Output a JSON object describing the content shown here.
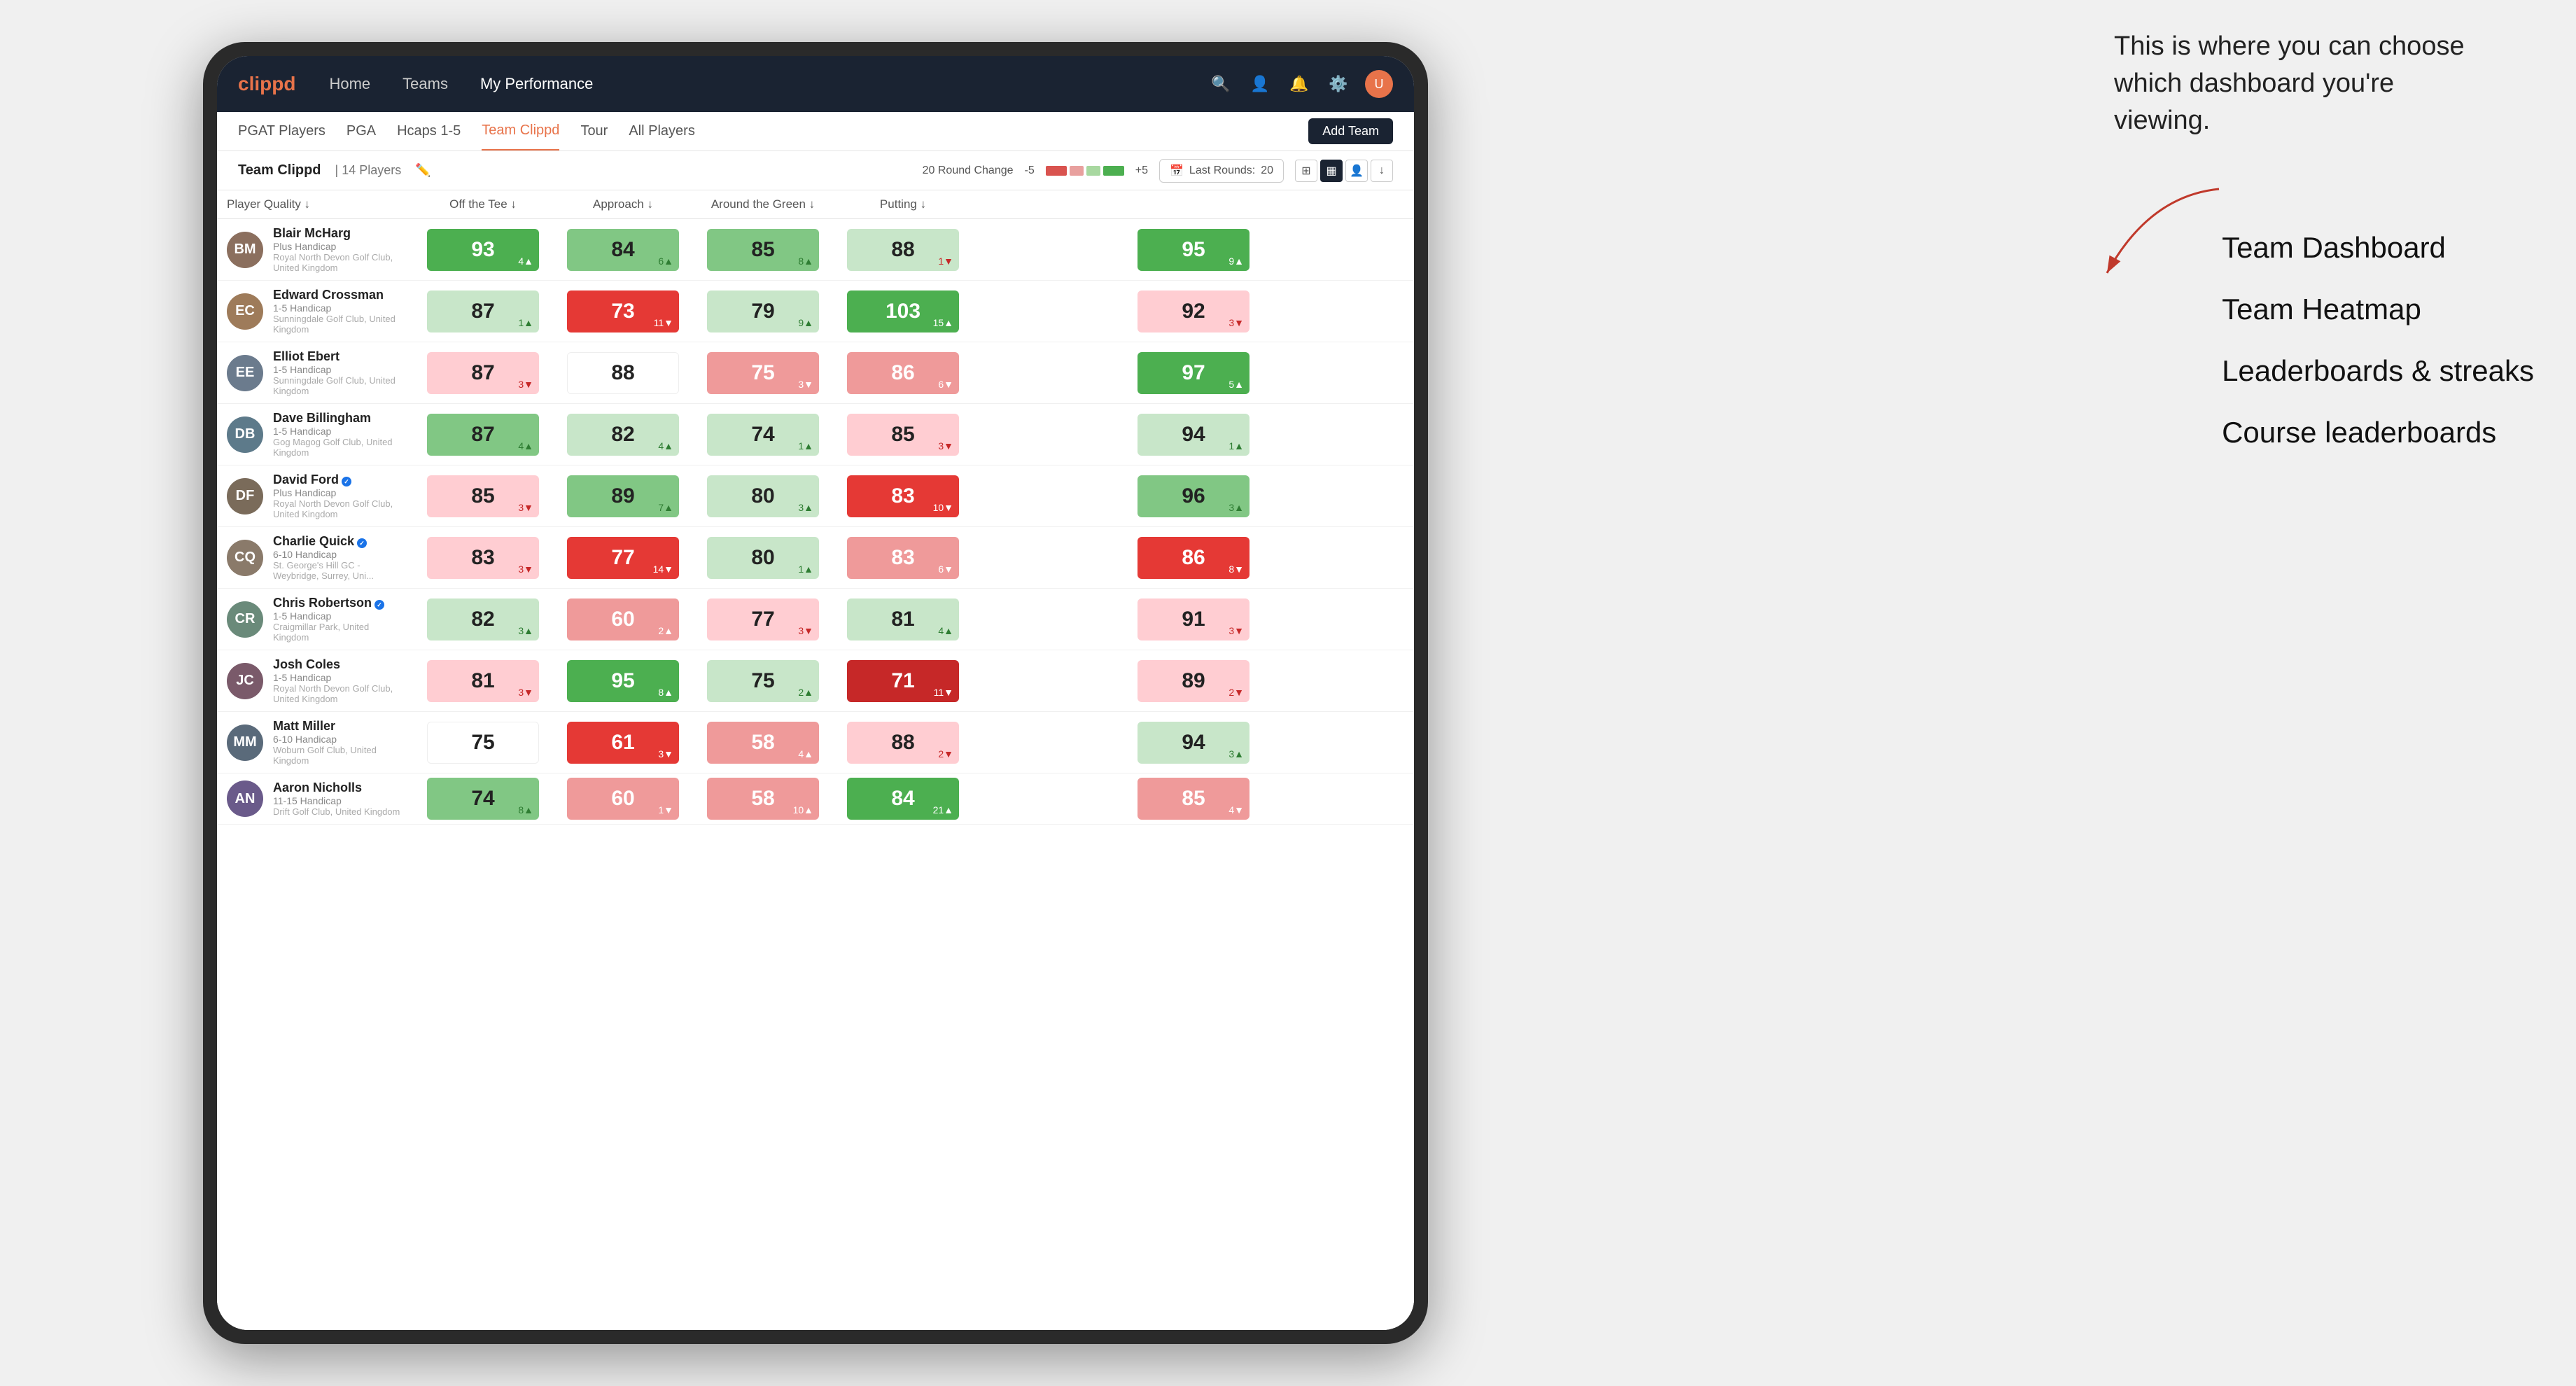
{
  "annotation": {
    "text": "This is where you can choose which dashboard you're viewing.",
    "labels": [
      "Team Dashboard",
      "Team Heatmap",
      "Leaderboards & streaks",
      "Course leaderboards"
    ]
  },
  "navbar": {
    "logo": "clippd",
    "links": [
      "Home",
      "Teams",
      "My Performance"
    ],
    "active_link": "My Performance"
  },
  "sub_tabs": {
    "tabs": [
      "PGAT Players",
      "PGA",
      "Hcaps 1-5",
      "Team Clippd",
      "Tour",
      "All Players"
    ],
    "active_tab": "Team Clippd",
    "add_team_label": "Add Team"
  },
  "team_header": {
    "title": "Team Clippd",
    "separator": "|",
    "count": "14 Players",
    "round_change_label": "20 Round Change",
    "range_min": "-5",
    "range_max": "+5",
    "last_rounds_label": "Last Rounds:",
    "last_rounds_value": "20"
  },
  "table": {
    "columns": [
      {
        "id": "player",
        "label": "Player Quality ↓"
      },
      {
        "id": "off_tee",
        "label": "Off the Tee ↓"
      },
      {
        "id": "approach",
        "label": "Approach ↓"
      },
      {
        "id": "around_green",
        "label": "Around the Green ↓"
      },
      {
        "id": "putting",
        "label": "Putting ↓"
      }
    ],
    "rows": [
      {
        "name": "Blair McHarg",
        "handicap": "Plus Handicap",
        "club": "Royal North Devon Golf Club, United Kingdom",
        "avatar_initials": "BM",
        "avatar_color": "#8B6F5E",
        "player_quality": {
          "value": 93,
          "change": 4,
          "dir": "up",
          "bg": "bg-green-strong"
        },
        "off_tee": {
          "value": 84,
          "change": 6,
          "dir": "up",
          "bg": "bg-green-medium"
        },
        "approach": {
          "value": 85,
          "change": 8,
          "dir": "up",
          "bg": "bg-green-medium"
        },
        "around_green": {
          "value": 88,
          "change": 1,
          "dir": "down",
          "bg": "bg-green-light"
        },
        "putting": {
          "value": 95,
          "change": 9,
          "dir": "up",
          "bg": "bg-green-strong"
        }
      },
      {
        "name": "Edward Crossman",
        "handicap": "1-5 Handicap",
        "club": "Sunningdale Golf Club, United Kingdom",
        "avatar_initials": "EC",
        "avatar_color": "#9E7B5A",
        "player_quality": {
          "value": 87,
          "change": 1,
          "dir": "up",
          "bg": "bg-green-light"
        },
        "off_tee": {
          "value": 73,
          "change": 11,
          "dir": "down",
          "bg": "bg-red-strong"
        },
        "approach": {
          "value": 79,
          "change": 9,
          "dir": "up",
          "bg": "bg-green-light"
        },
        "around_green": {
          "value": 103,
          "change": 15,
          "dir": "up",
          "bg": "bg-green-strong"
        },
        "putting": {
          "value": 92,
          "change": 3,
          "dir": "down",
          "bg": "bg-red-light"
        }
      },
      {
        "name": "Elliot Ebert",
        "handicap": "1-5 Handicap",
        "club": "Sunningdale Golf Club, United Kingdom",
        "avatar_initials": "EE",
        "avatar_color": "#6B7B8D",
        "player_quality": {
          "value": 87,
          "change": 3,
          "dir": "down",
          "bg": "bg-red-light"
        },
        "off_tee": {
          "value": 88,
          "change": 0,
          "dir": "none",
          "bg": "bg-white"
        },
        "approach": {
          "value": 75,
          "change": 3,
          "dir": "down",
          "bg": "bg-red-medium"
        },
        "around_green": {
          "value": 86,
          "change": 6,
          "dir": "down",
          "bg": "bg-red-medium"
        },
        "putting": {
          "value": 97,
          "change": 5,
          "dir": "up",
          "bg": "bg-green-strong"
        }
      },
      {
        "name": "Dave Billingham",
        "handicap": "1-5 Handicap",
        "club": "Gog Magog Golf Club, United Kingdom",
        "avatar_initials": "DB",
        "avatar_color": "#5D7A8A",
        "player_quality": {
          "value": 87,
          "change": 4,
          "dir": "up",
          "bg": "bg-green-medium"
        },
        "off_tee": {
          "value": 82,
          "change": 4,
          "dir": "up",
          "bg": "bg-green-light"
        },
        "approach": {
          "value": 74,
          "change": 1,
          "dir": "up",
          "bg": "bg-green-light"
        },
        "around_green": {
          "value": 85,
          "change": 3,
          "dir": "down",
          "bg": "bg-red-light"
        },
        "putting": {
          "value": 94,
          "change": 1,
          "dir": "up",
          "bg": "bg-green-light"
        }
      },
      {
        "name": "David Ford",
        "handicap": "Plus Handicap",
        "club": "Royal North Devon Golf Club, United Kingdom",
        "avatar_initials": "DF",
        "avatar_color": "#7A6B5A",
        "verified": true,
        "player_quality": {
          "value": 85,
          "change": 3,
          "dir": "down",
          "bg": "bg-red-light"
        },
        "off_tee": {
          "value": 89,
          "change": 7,
          "dir": "up",
          "bg": "bg-green-medium"
        },
        "approach": {
          "value": 80,
          "change": 3,
          "dir": "up",
          "bg": "bg-green-light"
        },
        "around_green": {
          "value": 83,
          "change": 10,
          "dir": "down",
          "bg": "bg-red-strong"
        },
        "putting": {
          "value": 96,
          "change": 3,
          "dir": "up",
          "bg": "bg-green-medium"
        }
      },
      {
        "name": "Charlie Quick",
        "handicap": "6-10 Handicap",
        "club": "St. George's Hill GC - Weybridge, Surrey, Uni...",
        "avatar_initials": "CQ",
        "avatar_color": "#8A7A6A",
        "verified": true,
        "player_quality": {
          "value": 83,
          "change": 3,
          "dir": "down",
          "bg": "bg-red-light"
        },
        "off_tee": {
          "value": 77,
          "change": 14,
          "dir": "down",
          "bg": "bg-red-strong"
        },
        "approach": {
          "value": 80,
          "change": 1,
          "dir": "up",
          "bg": "bg-green-light"
        },
        "around_green": {
          "value": 83,
          "change": 6,
          "dir": "down",
          "bg": "bg-red-medium"
        },
        "putting": {
          "value": 86,
          "change": 8,
          "dir": "down",
          "bg": "bg-red-strong"
        }
      },
      {
        "name": "Chris Robertson",
        "handicap": "1-5 Handicap",
        "club": "Craigmillar Park, United Kingdom",
        "avatar_initials": "CR",
        "avatar_color": "#6A8A7A",
        "verified": true,
        "player_quality": {
          "value": 82,
          "change": 3,
          "dir": "up",
          "bg": "bg-green-light"
        },
        "off_tee": {
          "value": 60,
          "change": 2,
          "dir": "up",
          "bg": "bg-red-medium"
        },
        "approach": {
          "value": 77,
          "change": 3,
          "dir": "down",
          "bg": "bg-red-light"
        },
        "around_green": {
          "value": 81,
          "change": 4,
          "dir": "up",
          "bg": "bg-green-light"
        },
        "putting": {
          "value": 91,
          "change": 3,
          "dir": "down",
          "bg": "bg-red-light"
        }
      },
      {
        "name": "Josh Coles",
        "handicap": "1-5 Handicap",
        "club": "Royal North Devon Golf Club, United Kingdom",
        "avatar_initials": "JC",
        "avatar_color": "#7A5A6A",
        "player_quality": {
          "value": 81,
          "change": 3,
          "dir": "down",
          "bg": "bg-red-light"
        },
        "off_tee": {
          "value": 95,
          "change": 8,
          "dir": "up",
          "bg": "bg-green-strong"
        },
        "approach": {
          "value": 75,
          "change": 2,
          "dir": "up",
          "bg": "bg-green-light"
        },
        "around_green": {
          "value": 71,
          "change": 11,
          "dir": "down",
          "bg": "bg-red-dark"
        },
        "putting": {
          "value": 89,
          "change": 2,
          "dir": "down",
          "bg": "bg-red-light"
        }
      },
      {
        "name": "Matt Miller",
        "handicap": "6-10 Handicap",
        "club": "Woburn Golf Club, United Kingdom",
        "avatar_initials": "MM",
        "avatar_color": "#5A6A7A",
        "player_quality": {
          "value": 75,
          "change": 0,
          "dir": "none",
          "bg": "bg-white"
        },
        "off_tee": {
          "value": 61,
          "change": 3,
          "dir": "down",
          "bg": "bg-red-strong"
        },
        "approach": {
          "value": 58,
          "change": 4,
          "dir": "up",
          "bg": "bg-red-medium"
        },
        "around_green": {
          "value": 88,
          "change": 2,
          "dir": "down",
          "bg": "bg-red-light"
        },
        "putting": {
          "value": 94,
          "change": 3,
          "dir": "up",
          "bg": "bg-green-light"
        }
      },
      {
        "name": "Aaron Nicholls",
        "handicap": "11-15 Handicap",
        "club": "Drift Golf Club, United Kingdom",
        "avatar_initials": "AN",
        "avatar_color": "#6A5A8A",
        "player_quality": {
          "value": 74,
          "change": 8,
          "dir": "up",
          "bg": "bg-green-medium"
        },
        "off_tee": {
          "value": 60,
          "change": 1,
          "dir": "down",
          "bg": "bg-red-medium"
        },
        "approach": {
          "value": 58,
          "change": 10,
          "dir": "up",
          "bg": "bg-red-medium"
        },
        "around_green": {
          "value": 84,
          "change": 21,
          "dir": "up",
          "bg": "bg-green-strong"
        },
        "putting": {
          "value": 85,
          "change": 4,
          "dir": "down",
          "bg": "bg-red-medium"
        }
      }
    ]
  }
}
